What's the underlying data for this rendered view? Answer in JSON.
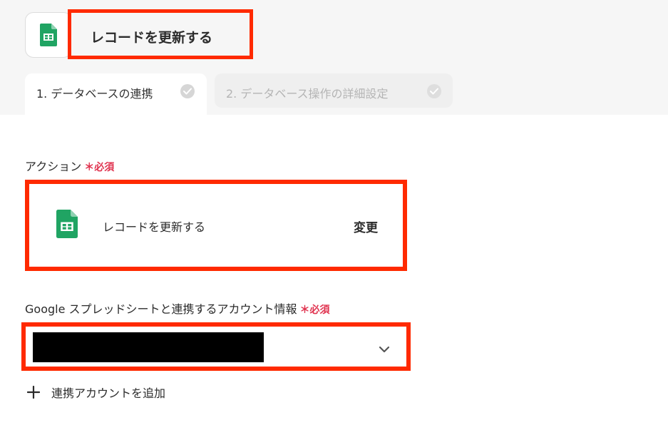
{
  "header": {
    "title": "レコードを更新する",
    "app_icon": "google-sheets-icon"
  },
  "tabs": [
    {
      "label": "1. データベースの連携",
      "state": "active",
      "icon": "check-circle-icon"
    },
    {
      "label": "2. データベース操作の詳細設定",
      "state": "inactive",
      "icon": "check-circle-icon"
    }
  ],
  "action_section": {
    "label": "アクション",
    "required_mark": "＊",
    "required_text": "必須",
    "selected_action": "レコードを更新する",
    "change_label": "変更"
  },
  "account_section": {
    "label": "Google スプレッドシートと連携するアカウント情報",
    "required_mark": "＊",
    "required_text": "必須",
    "add_account_label": "連携アカウントを追加"
  },
  "colors": {
    "highlight": "#ff2a00",
    "required": "#e0334f",
    "sheets_green": "#20a463"
  }
}
